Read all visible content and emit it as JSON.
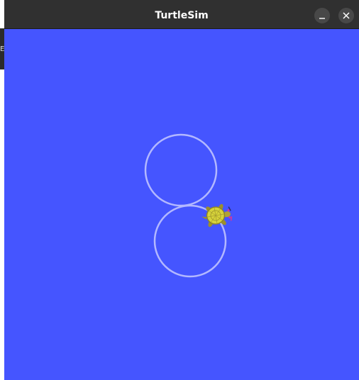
{
  "window": {
    "title": "TurtleSim",
    "minimize_icon": "minimize-icon",
    "close_icon": "close-icon"
  },
  "background_window": {
    "glyph": "E"
  },
  "simulation": {
    "background_color": "#4555ff",
    "pen_color": "#b3b8ff",
    "turtle_icon": "turtle-icon",
    "turtle_color": "#d6d33a",
    "path": [
      "upper-circle",
      "lower-circle"
    ]
  }
}
